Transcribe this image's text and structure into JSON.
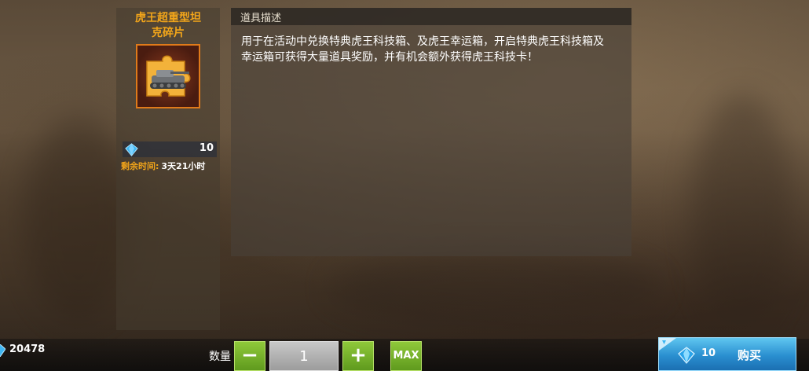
{
  "item": {
    "name_line1": "虎王超重型坦",
    "name_line2": "克碎片",
    "icon": "tank-puzzle-piece-icon",
    "price": "10",
    "time_label": "剩余时间:",
    "time_value": "3天21小时"
  },
  "description": {
    "title": "道具描述",
    "text": "用于在活动中兑换特典虎王科技箱、及虎王幸运箱，开启特典虎王科技箱及幸运箱可获得大量道具奖励，并有机会额外获得虎王科技卡！"
  },
  "footer": {
    "balance": "20478",
    "quantity_label": "数量",
    "minus_label": "−",
    "quantity_value": "1",
    "plus_label": "+",
    "max_label": "MAX",
    "buy_price": "10",
    "buy_label": "购买"
  },
  "colors": {
    "accent_orange": "#f2a51a",
    "button_green": "#6fab24",
    "button_blue": "#2a8fd0"
  }
}
